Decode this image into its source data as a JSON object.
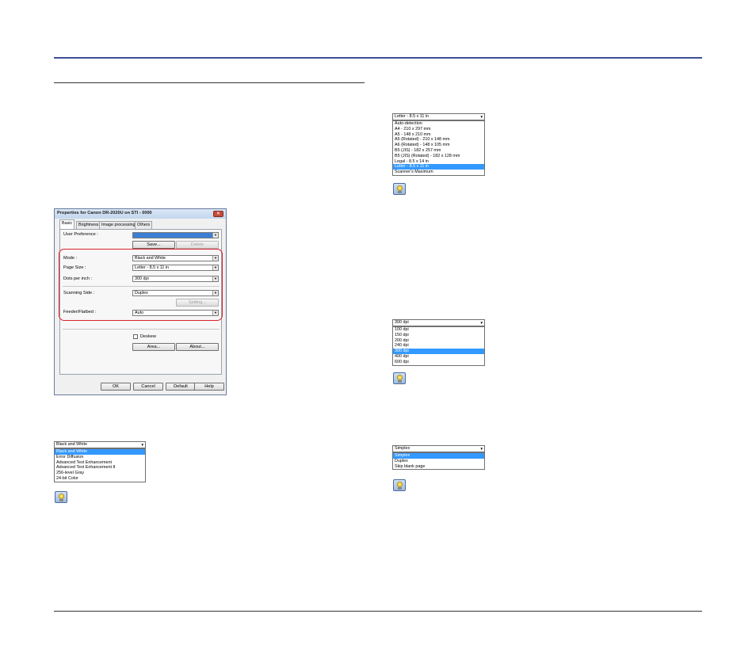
{
  "dialog": {
    "title": "Properties for Canon DR-2020U on STI - 0000",
    "close": "✕",
    "tabs": [
      "Basic",
      "Brightness",
      "Image processing",
      "Others"
    ],
    "user_preference_label": "User Preference :",
    "user_preference_value": "",
    "save_button": "Save...",
    "delete_button": "Delete",
    "mode_label": "Mode :",
    "mode_value": "Black and White",
    "page_size_label": "Page Size :",
    "page_size_value": "Letter - 8.5 x 11 in",
    "dpi_label": "Dots per inch :",
    "dpi_value": "300 dpi",
    "scanning_side_label": "Scanning Side :",
    "scanning_side_value": "Duplex",
    "setting_button": "Setting...",
    "feeder_label": "Feeder/Flatbed :",
    "feeder_value": "Auto",
    "deskew_label": "Deskew",
    "area_button": "Area...",
    "about_button": "About...",
    "ok_button": "OK",
    "cancel_button": "Cancel",
    "default_button": "Default",
    "help_button": "Help"
  },
  "mode_dropdown": {
    "current": "Black and White",
    "items": [
      "Black and White",
      "Error Diffusion",
      "Advanced Text Enhancement",
      "Advanced Text Enhancement II",
      "256-level Gray",
      "24-bit Color"
    ],
    "selected_index": 0
  },
  "page_size_dropdown": {
    "current": "Letter - 8.5 x 11 in",
    "items": [
      "Auto-detection",
      "A4 - 210 x 297 mm",
      "A5 - 148 x 210 mm",
      "A5 (Rotated) - 210 x 148 mm",
      "A6 (Rotated) - 148 x 105 mm",
      "B5 (JIS) - 182 x 257 mm",
      "B5 (JIS) (Rotated) - 182 x 128 mm",
      "Legal - 8.5 x 14 in",
      "Letter - 8.5 x 11 in",
      "Scanner's Maximum"
    ],
    "selected_index": 8
  },
  "dpi_dropdown": {
    "current": "300 dpi",
    "items": [
      "100 dpi",
      "150 dpi",
      "200 dpi",
      "240 dpi",
      "300 dpi",
      "400 dpi",
      "600 dpi"
    ],
    "selected_index": 4
  },
  "scanning_side_dropdown": {
    "current": "Simplex",
    "items": [
      "Simplex",
      "Duplex",
      "Skip blank page"
    ],
    "selected_index": 0
  },
  "colors": {
    "accent_rule": "#3e4f9a",
    "highlight": "#d9202a",
    "selection": "#3399ff"
  },
  "icons": [
    "lightbulb-hint-icon"
  ]
}
